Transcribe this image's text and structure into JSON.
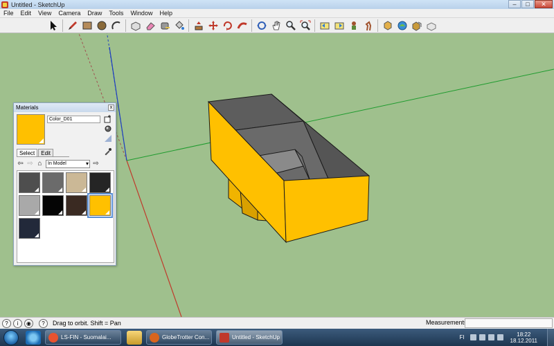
{
  "window": {
    "title": "Untitled - SketchUp",
    "minimize": "–",
    "maximize": "□",
    "close": "✕"
  },
  "menu": [
    "File",
    "Edit",
    "View",
    "Camera",
    "Draw",
    "Tools",
    "Window",
    "Help"
  ],
  "toolbar": {
    "tools": [
      "select-arrow-icon",
      "pencil-line-icon",
      "rectangle-icon",
      "circle-icon",
      "arc-icon",
      "make-component-icon",
      "eraser-icon",
      "tape-measure-icon",
      "paint-bucket-icon",
      "push-pull-icon",
      "move-icon",
      "rotate-icon",
      "follow-me-icon",
      "orbit-icon",
      "pan-hand-icon",
      "zoom-icon",
      "zoom-extents-icon",
      "previous-view-icon",
      "next-view-icon",
      "position-camera-icon",
      "walk-icon",
      "get-models-icon",
      "share-model-icon",
      "get-components-icon",
      "share-component-icon"
    ]
  },
  "materials": {
    "title": "Materials",
    "close": "x",
    "selected_name": "Color_D01",
    "selected_color": "#ffc000",
    "tabs": [
      "Select",
      "Edit"
    ],
    "library": "In Model",
    "swatches": [
      {
        "color": "#4e4e4e"
      },
      {
        "color": "#6b6b6b"
      },
      {
        "color": "#cbb896"
      },
      {
        "color": "#252525"
      },
      {
        "color": "#a9a9a9"
      },
      {
        "color": "#050505"
      },
      {
        "color": "#3a2a22"
      },
      {
        "color": "#ffc000",
        "selected": true
      },
      {
        "color": "#22293a"
      }
    ]
  },
  "status": {
    "hint": "Drag to orbit.  Shift = Pan",
    "measurements_label": "Measurements"
  },
  "taskbar": {
    "items": [
      {
        "label": "LS-FIN - Suomalai...",
        "icon_color": "#e8532f"
      },
      {
        "label": "GlobeTrotter Con...",
        "icon_color": "#d9651d"
      },
      {
        "label": "Untitled - SketchUp",
        "icon_color": "#c0392b",
        "active": true
      }
    ],
    "language": "FI",
    "time": "18:22",
    "date": "18.12.2011"
  },
  "colors": {
    "ground": "#9fc08d",
    "box_yellow": "#ffc000",
    "box_inner": "#5a5a5a",
    "axis_red": "#c0392b",
    "axis_green": "#1e9b2e",
    "axis_blue": "#1f3fbf"
  }
}
